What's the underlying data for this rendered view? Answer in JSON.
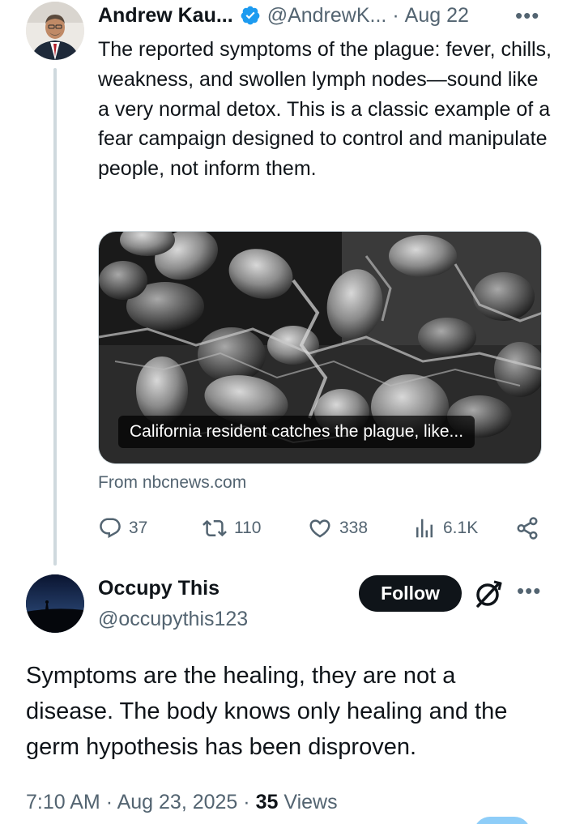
{
  "tweet": {
    "author_name": "Andrew Kau...",
    "verified": true,
    "handle": "@AndrewK...",
    "separator": "·",
    "date": "Aug 22",
    "more": "•••",
    "text": "The reported symptoms of the plague: fever, chills, weakness, and swollen lymph nodes—sound like a very normal detox. This is a classic example of a fear campaign designed to control and manipulate people, not inform them.",
    "card": {
      "caption": "California resident catches the plague, like...",
      "source": "From nbcnews.com"
    },
    "stats": {
      "replies": "37",
      "reposts": "110",
      "likes": "338",
      "views": "6.1K"
    }
  },
  "reply": {
    "author_name": "Occupy This",
    "handle": "@occupythis123",
    "follow_label": "Follow",
    "more": "•••",
    "text": "Symptoms are the healing, they are not a disease. The body knows only healing and the germ hypothesis has been disproven.",
    "meta": {
      "time": "7:10 AM",
      "sep1": "·",
      "date": "Aug 23, 2025",
      "sep2": "·",
      "views_count": "35",
      "views_label": "Views"
    }
  },
  "colors": {
    "text_primary": "#0f1419",
    "text_secondary": "#536471",
    "verified_blue": "#1d9bf0",
    "thread_line": "#cfd9de",
    "follow_bg": "#0f1419"
  }
}
